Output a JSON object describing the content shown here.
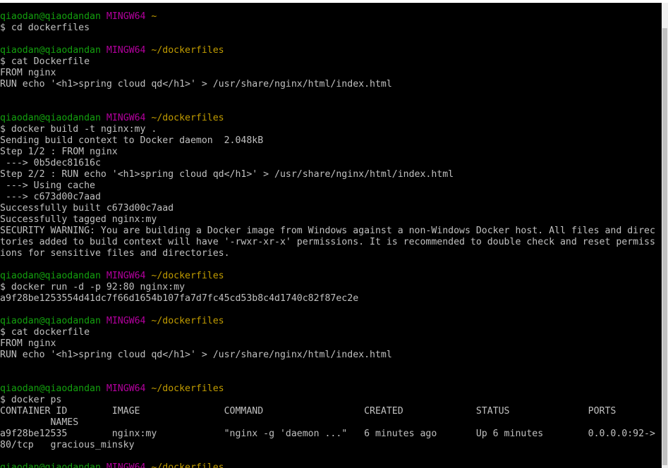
{
  "prompt_header": {
    "user": "qiaodan@qiaodandan",
    "shell": "MINGW64"
  },
  "terminal": {
    "lines": [
      {
        "type": "prompt",
        "path": "~"
      },
      {
        "type": "text",
        "text": "$ cd dockerfiles"
      },
      {
        "type": "text",
        "text": ""
      },
      {
        "type": "prompt",
        "path": "~/dockerfiles"
      },
      {
        "type": "text",
        "text": "$ cat Dockerfile"
      },
      {
        "type": "text",
        "text": "FROM nginx"
      },
      {
        "type": "text",
        "text": "RUN echo '<h1>spring cloud qd</h1>' > /usr/share/nginx/html/index.html"
      },
      {
        "type": "text",
        "text": ""
      },
      {
        "type": "text",
        "text": ""
      },
      {
        "type": "prompt",
        "path": "~/dockerfiles"
      },
      {
        "type": "text",
        "text": "$ docker build -t nginx:my ."
      },
      {
        "type": "text",
        "text": "Sending build context to Docker daemon  2.048kB"
      },
      {
        "type": "text",
        "text": "Step 1/2 : FROM nginx"
      },
      {
        "type": "text",
        "text": " ---> 0b5dec81616c"
      },
      {
        "type": "text",
        "text": "Step 2/2 : RUN echo '<h1>spring cloud qd</h1>' > /usr/share/nginx/html/index.html"
      },
      {
        "type": "text",
        "text": " ---> Using cache"
      },
      {
        "type": "text",
        "text": " ---> c673d00c7aad"
      },
      {
        "type": "text",
        "text": "Successfully built c673d00c7aad"
      },
      {
        "type": "text",
        "text": "Successfully tagged nginx:my"
      },
      {
        "type": "text",
        "text": "SECURITY WARNING: You are building a Docker image from Windows against a non-Windows Docker host. All files and direc"
      },
      {
        "type": "text",
        "text": "tories added to build context will have '-rwxr-xr-x' permissions. It is recommended to double check and reset permiss"
      },
      {
        "type": "text",
        "text": "ions for sensitive files and directories."
      },
      {
        "type": "text",
        "text": ""
      },
      {
        "type": "prompt",
        "path": "~/dockerfiles"
      },
      {
        "type": "text",
        "text": "$ docker run -d -p 92:80 nginx:my"
      },
      {
        "type": "text",
        "text": "a9f28be1253554d41dc7f66d1654b107fa7d7fc45cd53b8c4d1740c82f87ec2e"
      },
      {
        "type": "text",
        "text": ""
      },
      {
        "type": "prompt",
        "path": "~/dockerfiles"
      },
      {
        "type": "text",
        "text": "$ cat dockerfile"
      },
      {
        "type": "text",
        "text": "FROM nginx"
      },
      {
        "type": "text",
        "text": "RUN echo '<h1>spring cloud qd</h1>' > /usr/share/nginx/html/index.html"
      },
      {
        "type": "text",
        "text": ""
      },
      {
        "type": "text",
        "text": ""
      },
      {
        "type": "prompt",
        "path": "~/dockerfiles"
      },
      {
        "type": "text",
        "text": "$ docker ps"
      },
      {
        "type": "text",
        "text": "CONTAINER ID        IMAGE               COMMAND                  CREATED             STATUS              PORTS"
      },
      {
        "type": "text",
        "text": "         NAMES"
      },
      {
        "type": "text",
        "text": "a9f28be12535        nginx:my            \"nginx -g 'daemon ...\"   6 minutes ago       Up 6 minutes        0.0.0.0:92->"
      },
      {
        "type": "text",
        "text": "80/tcp   gracious_minsky"
      },
      {
        "type": "text",
        "text": ""
      },
      {
        "type": "prompt",
        "path": "~/dockerfiles"
      }
    ]
  },
  "colors": {
    "background": "#000000",
    "foreground": "#c0c0c0",
    "prompt_user": "#13a10e",
    "prompt_shell": "#b4009e",
    "prompt_path": "#c19c00"
  }
}
